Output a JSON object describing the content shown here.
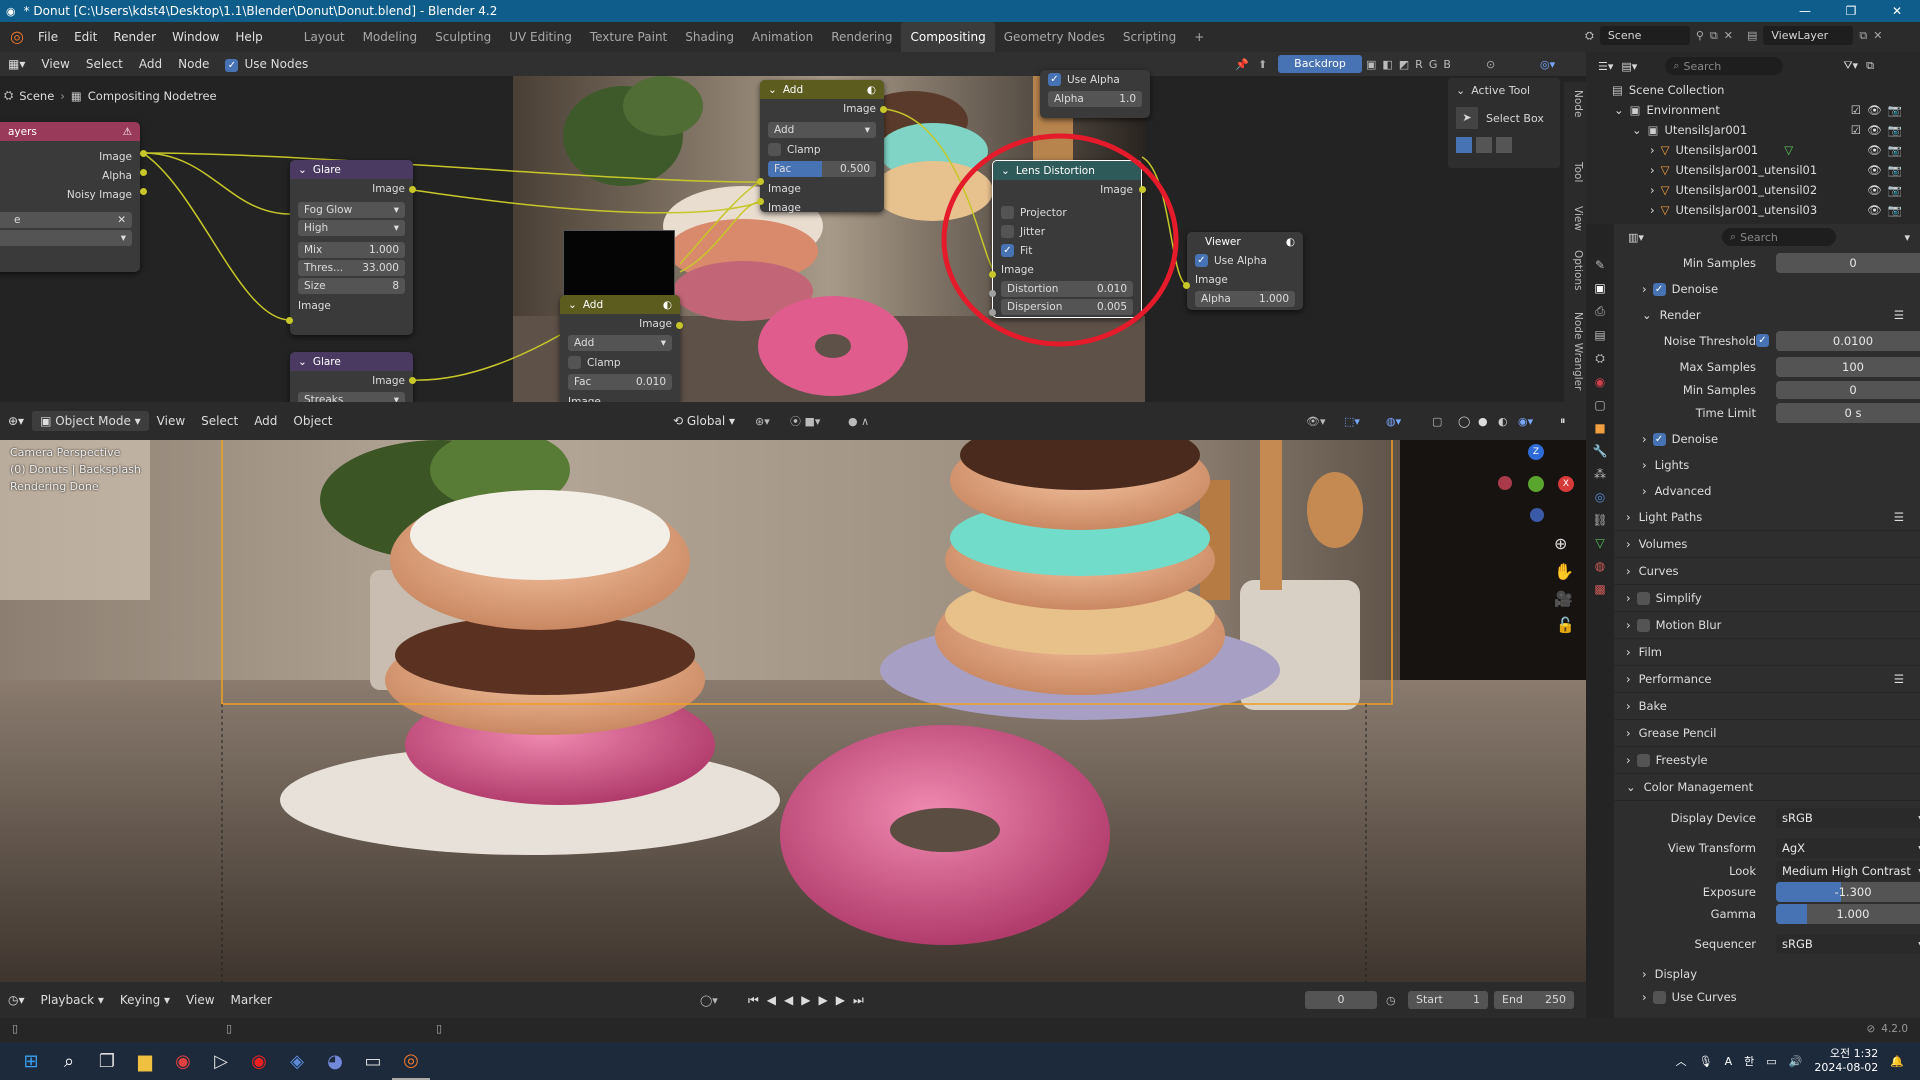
{
  "window": {
    "title": "* Donut [C:\\Users\\kdst4\\Desktop\\1.1\\Blender\\Donut\\Donut.blend] - Blender 4.2"
  },
  "menu": {
    "file": "File",
    "edit": "Edit",
    "render": "Render",
    "window": "Window",
    "help": "Help"
  },
  "workspaces": [
    "Layout",
    "Modeling",
    "Sculpting",
    "UV Editing",
    "Texture Paint",
    "Shading",
    "Animation",
    "Rendering",
    "Compositing",
    "Geometry Nodes",
    "Scripting"
  ],
  "scene": {
    "name": "Scene",
    "view_layer": "ViewLayer"
  },
  "node_editor": {
    "view": "View",
    "select": "Select",
    "add": "Add",
    "node": "Node",
    "use_nodes": "Use Nodes",
    "backdrop": "Backdrop",
    "breadcrumb_scene": "Scene",
    "breadcrumb_tree": "Compositing Nodetree",
    "active_tool": "Active Tool",
    "select_box": "Select Box",
    "side_tabs": [
      "Node",
      "Tool",
      "View",
      "Options",
      "Node Wrangler"
    ],
    "render_layers": {
      "title": "ayers",
      "image": "Image",
      "alpha": "Alpha",
      "noisy": "Noisy Image",
      "field": "e"
    },
    "glare1": {
      "title": "Glare",
      "image": "Image",
      "type": "Fog Glow",
      "quality": "High",
      "mix_label": "Mix",
      "mix": "1.000",
      "thres_label": "Thres...",
      "thres": "33.000",
      "size_label": "Size",
      "size": "8",
      "in": "Image"
    },
    "glare2": {
      "title": "Glare",
      "image": "Image",
      "type": "Streaks"
    },
    "add1": {
      "title": "Add",
      "image": "Image",
      "op": "Add",
      "clamp": "Clamp",
      "fac_label": "Fac",
      "fac": "0.500",
      "in1": "Image",
      "in2": "Image"
    },
    "add2": {
      "title": "Add",
      "image": "Image",
      "op": "Add",
      "clamp": "Clamp",
      "fac_label": "Fac",
      "fac": "0.010",
      "in1": "Image"
    },
    "lens": {
      "title": "Lens Distortion",
      "image": "Image",
      "projector": "Projector",
      "jitter": "Jitter",
      "fit": "Fit",
      "in": "Image",
      "dist_label": "Distortion",
      "dist": "0.010",
      "disp_label": "Dispersion",
      "disp": "0.005"
    },
    "viewer": {
      "title": "Viewer",
      "use_alpha": "Use Alpha",
      "image": "Image",
      "alpha_label": "Alpha",
      "alpha": "1.000"
    },
    "composite": {
      "use_alpha": "Use Alpha",
      "alpha_label": "Alpha",
      "alpha": "1.0"
    }
  },
  "viewport": {
    "mode": "Object Mode",
    "view": "View",
    "select": "Select",
    "add": "Add",
    "object": "Object",
    "orientation": "Global",
    "overlay_line1": "Camera Perspective",
    "overlay_line2": "(0) Donuts | Backsplash",
    "overlay_line3": "Rendering Done"
  },
  "timeline": {
    "playback": "Playback",
    "keying": "Keying",
    "view": "View",
    "marker": "Marker",
    "frame": "0",
    "start_label": "Start",
    "start": "1",
    "end_label": "End",
    "end": "250"
  },
  "outliner": {
    "search": "Search",
    "items": [
      {
        "label": "Scene Collection"
      },
      {
        "label": "Environment"
      },
      {
        "label": "UtensilsJar001"
      },
      {
        "label": "UtensilsJar001"
      },
      {
        "label": "UtensilsJar001_utensil01"
      },
      {
        "label": "UtensilsJar001_utensil02"
      },
      {
        "label": "UtensilsJar001_utensil03"
      }
    ]
  },
  "properties": {
    "search": "Search",
    "min_samples_top_label": "Min Samples",
    "min_samples_top": "0",
    "denoise1": "Denoise",
    "render": "Render",
    "noise_threshold_label": "Noise Threshold",
    "noise_threshold": "0.0100",
    "max_samples_label": "Max Samples",
    "max_samples": "100",
    "min_samples_label": "Min Samples",
    "min_samples": "0",
    "time_limit_label": "Time Limit",
    "time_limit": "0 s",
    "denoise2": "Denoise",
    "lights": "Lights",
    "advanced": "Advanced",
    "sections": [
      "Light Paths",
      "Volumes",
      "Curves",
      "Simplify",
      "Motion Blur",
      "Film",
      "Performance",
      "Bake",
      "Grease Pencil",
      "Freestyle"
    ],
    "color_management": "Color Management",
    "display_device_label": "Display Device",
    "display_device": "sRGB",
    "view_transform_label": "View Transform",
    "view_transform": "AgX",
    "look_label": "Look",
    "look": "Medium High Contrast",
    "exposure_label": "Exposure",
    "exposure": "-1.300",
    "exposure_fill": 0.42,
    "gamma_label": "Gamma",
    "gamma": "1.000",
    "gamma_fill": 0.2,
    "sequencer_label": "Sequencer",
    "sequencer": "sRGB",
    "display": "Display",
    "use_curves": "Use Curves"
  },
  "status": {
    "version": "4.2.0"
  },
  "taskbar": {
    "lang": "A",
    "ime": "한",
    "time": "오전 1:32",
    "date": "2024-08-02"
  }
}
